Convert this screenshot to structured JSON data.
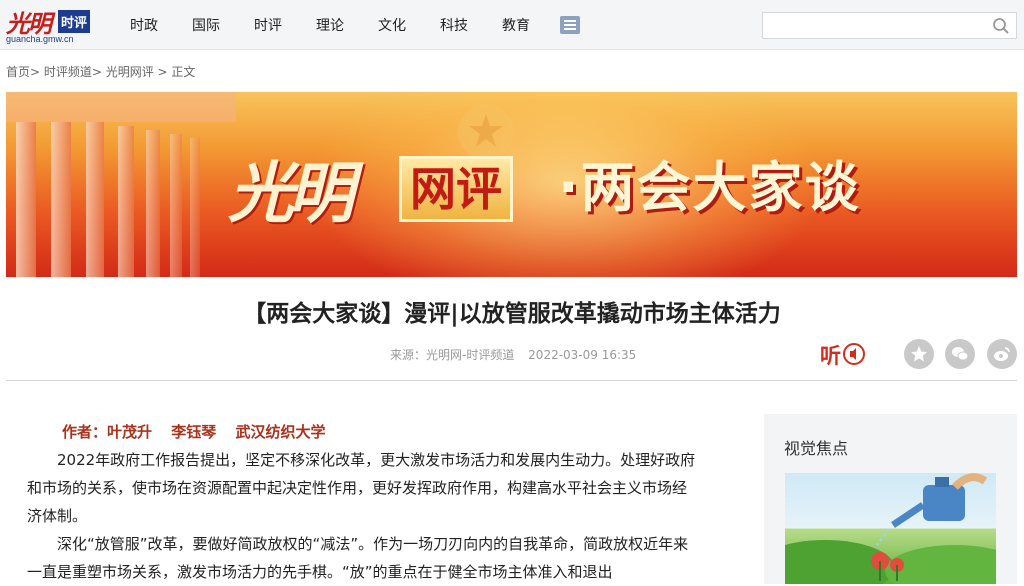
{
  "header": {
    "logo_script": "光明",
    "logo_badge": "时评",
    "logo_domain": "guancha.gmw.cn",
    "nav": [
      "时政",
      "国际",
      "时评",
      "理论",
      "文化",
      "科技",
      "教育"
    ],
    "search_placeholder": ""
  },
  "breadcrumb": {
    "text": "首页> 时评频道> 光明网评 > 正文"
  },
  "banner": {
    "script": "光明",
    "box": "网评",
    "title": "·两会大家谈"
  },
  "article": {
    "title": "【两会大家谈】漫评|以放管服改革撬动市场主体活力",
    "source": "来源：光明网-时评频道",
    "datetime": "2022-03-09 16:35",
    "listen_label": "听",
    "author_label": "作者：叶茂升",
    "author2": "李钰琴",
    "author_org": "武汉纺织大学",
    "paragraphs": [
      "2022年政府工作报告提出，坚定不移深化改革，更大激发市场活力和发展内生动力。处理好政府和市场的关系，使市场在资源配置中起决定性作用，更好发挥政府作用，构建高水平社会主义市场经济体制。",
      "深化“放管服”改革，要做好简政放权的“减法”。作为一场刀刃向内的自我革命，简政放权近年来一直是重塑市场关系，激发市场活力的先手棋。“放”的重点在于健全市场主体准入和退出"
    ]
  },
  "sidebar": {
    "title": "视觉焦点"
  },
  "colors": {
    "brand_red": "#c81d1d",
    "brand_blue": "#1d3b8f",
    "author_color": "#a8321c"
  }
}
